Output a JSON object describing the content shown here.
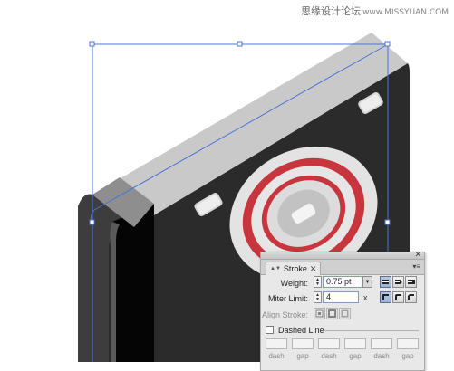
{
  "watermark": {
    "text": "思缘设计论坛",
    "site": "www.MISSYUAN.COM"
  },
  "stroke_panel": {
    "tab_label": "Stroke",
    "tab_arrows": "▲▼",
    "close_glyph": "✕",
    "panel_close_glyph": "✕",
    "menu_glyph": "▾≡",
    "weight_label": "Weight:",
    "weight_value": "0.75 pt",
    "miter_label": "Miter Limit:",
    "miter_value": "4",
    "miter_x": "x",
    "align_label": "Align Stroke:",
    "dashed_label": "Dashed Line",
    "dashed_checked": false,
    "dash_labels": [
      "dash",
      "gap",
      "dash",
      "gap",
      "dash",
      "gap"
    ],
    "cap_buttons": [
      "butt-cap",
      "round-cap",
      "projecting-cap"
    ],
    "join_buttons": [
      "miter-join",
      "round-join",
      "bevel-join"
    ],
    "align_buttons": [
      "align-center",
      "align-inside",
      "align-outside"
    ]
  },
  "colors": {
    "camera_body": "#2b2b2b",
    "camera_top": "#c9c9c9",
    "lens_red": "#c8363d",
    "selection_blue": "#4a74d8",
    "panel_bg": "#e8e8e8"
  }
}
